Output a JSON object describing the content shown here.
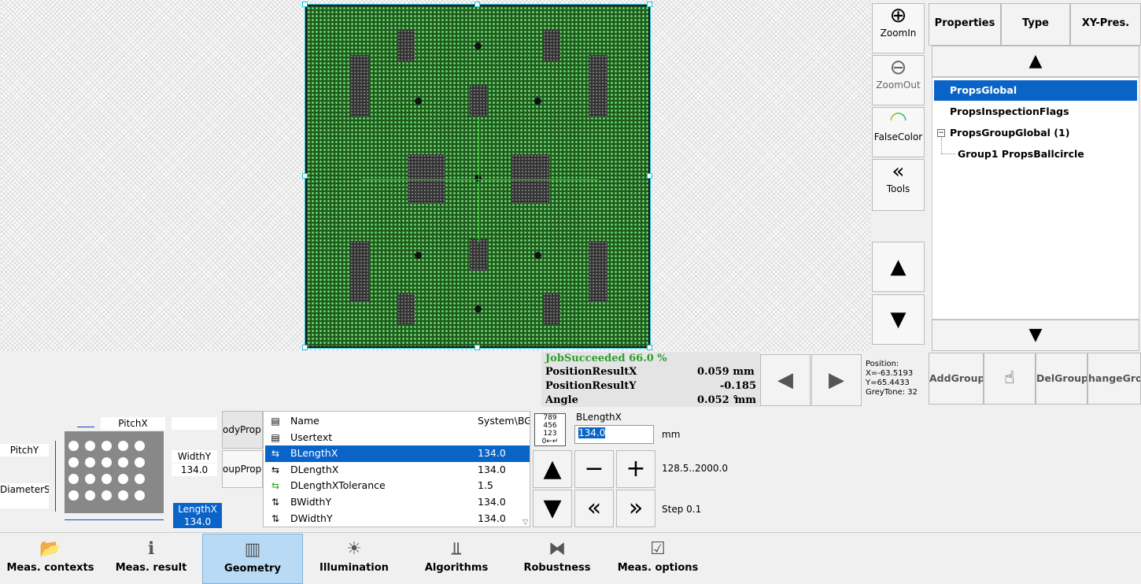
{
  "tools": {
    "zoom_in": "ZoomIn",
    "zoom_out": "ZoomOut",
    "false_color": "FalseColor",
    "tools": "Tools"
  },
  "right_tabs": [
    "Properties",
    "Type",
    "XY-Pres."
  ],
  "tree": {
    "items": [
      "PropsGlobal",
      "PropsInspectionFlags",
      "PropsGroupGlobal (1)",
      "Group1 PropsBallcircle"
    ],
    "selected": 0
  },
  "group_buttons": {
    "add": "AddGroup",
    "del": "DelGroup",
    "change": "hangeGrou"
  },
  "results": {
    "status": "JobSucceeded 66.0 %",
    "rows": [
      {
        "label": "PositionResultX",
        "value": "0.059 mm"
      },
      {
        "label": "PositionResultY",
        "value": "-0.185 mm"
      },
      {
        "label": "Angle",
        "value": "0.052 °"
      }
    ]
  },
  "position": {
    "title": "Position:",
    "x": "X=-63.5193",
    "y": "Y=65.4433",
    "grey": "GreyTone: 32"
  },
  "diagram": {
    "pitch_x": "PitchX",
    "pitch_y": "PitchY",
    "diameter": "DiameterS",
    "width_y_label": "WidthY",
    "width_y_value": "134.0",
    "length_x_label": "LengthX",
    "length_x_value": "134.0"
  },
  "side_tabs": [
    "odyProp",
    "oupProp"
  ],
  "properties": [
    {
      "name": "Name",
      "value": "System\\BGA",
      "icon": "doc-icon"
    },
    {
      "name": "Usertext",
      "value": "",
      "icon": "doc-icon"
    },
    {
      "name": "BLengthX",
      "value": "134.0",
      "icon": "horizontal-dimension-icon"
    },
    {
      "name": "DLengthX",
      "value": "134.0",
      "icon": "horizontal-dimension-icon"
    },
    {
      "name": "DLengthXTolerance",
      "value": "1.5",
      "icon": "horizontal-tolerance-icon"
    },
    {
      "name": "BWidthY",
      "value": "134.0",
      "icon": "vertical-dimension-icon"
    },
    {
      "name": "DWidthY",
      "value": "134.0",
      "icon": "vertical-dimension-icon"
    }
  ],
  "selected_property": 2,
  "editor": {
    "param_name": "BLengthX",
    "value": "134.0",
    "unit": "mm",
    "range": "128.5..2000.0",
    "step": "Step 0.1"
  },
  "nav": {
    "tabs": [
      "Meas. contexts",
      "Meas. result",
      "Geometry",
      "Illumination",
      "Algorithms",
      "Robustness",
      "Meas. options"
    ],
    "active": 2
  },
  "colors": {
    "selection": "#0a64c8",
    "board": "#1f5a1f",
    "frame": "#1cc6d8",
    "status_ok": "#2e9e2e",
    "active_tab": "#b8daf5"
  }
}
